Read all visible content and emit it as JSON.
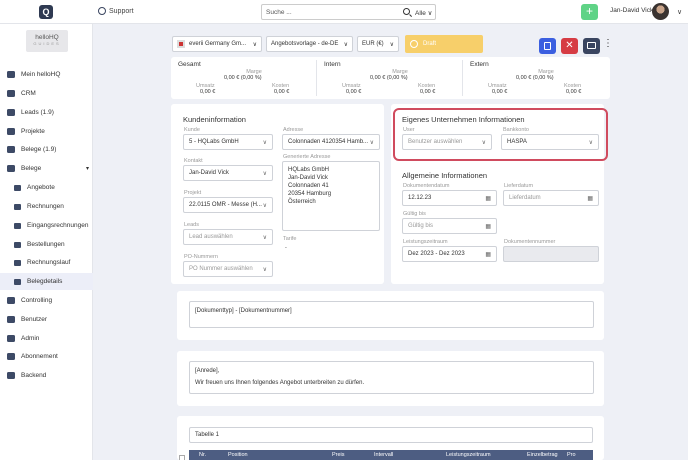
{
  "header": {
    "logo": "Q",
    "support": "Support",
    "search_placeholder": "Suche ...",
    "search_scope": "Alle",
    "plus": "+",
    "user_name": "Jan-David Vick",
    "chevron": "∨"
  },
  "brand": {
    "name": "helloHQ",
    "sub": "GUIDES"
  },
  "sidebar": {
    "items": [
      {
        "label": "Mein helloHQ",
        "icon": "home-icon"
      },
      {
        "label": "CRM",
        "icon": "crm-icon"
      },
      {
        "label": "Leads (1.9)",
        "icon": "leads-icon"
      },
      {
        "label": "Projekte",
        "icon": "projects-icon"
      },
      {
        "label": "Belege (1.9)",
        "icon": "receipts-icon"
      },
      {
        "label": "Belege",
        "icon": "documents-icon",
        "caret": "▾"
      },
      {
        "label": "Angebote",
        "icon": "offers-icon"
      },
      {
        "label": "Rechnungen",
        "icon": "invoices-icon"
      },
      {
        "label": "Eingangsrechnungen",
        "icon": "incoming-invoices-icon"
      },
      {
        "label": "Bestellungen",
        "icon": "orders-icon"
      },
      {
        "label": "Rechnungslauf",
        "icon": "invoice-run-icon"
      },
      {
        "label": "Belegdetails",
        "icon": "document-details-icon"
      },
      {
        "label": "Controlling",
        "icon": "controlling-icon"
      },
      {
        "label": "Benutzer",
        "icon": "users-icon"
      },
      {
        "label": "Admin",
        "icon": "admin-icon"
      },
      {
        "label": "Abonnement",
        "icon": "subscription-icon"
      },
      {
        "label": "Backend",
        "icon": "backend-icon"
      }
    ]
  },
  "toolbar": {
    "company": "everii Germany Gm...",
    "template": "Angebotsvorlage - de-DE",
    "currency": "EUR (€)",
    "status": "Draft",
    "more": "⋮"
  },
  "summary": [
    {
      "title": "Gesamt",
      "marge_label": "Marge",
      "marge": "0,00 € (0,00 %)",
      "umsatz_label": "Umsatz",
      "umsatz": "0,00 €",
      "kosten_label": "Kosten",
      "kosten": "0,00 €"
    },
    {
      "title": "Intern",
      "marge_label": "Marge",
      "marge": "0,00 € (0,00 %)",
      "umsatz_label": "Umsatz",
      "umsatz": "0,00 €",
      "kosten_label": "Kosten",
      "kosten": "0,00 €"
    },
    {
      "title": "Extern",
      "marge_label": "Marge",
      "marge": "0,00 € (0,00 %)",
      "umsatz_label": "Umsatz",
      "umsatz": "0,00 €",
      "kosten_label": "Kosten",
      "kosten": "0,00 €"
    }
  ],
  "kunde": {
    "title": "Kundeninformation",
    "kunde_label": "Kunde",
    "kunde": "5 - HQLabs GmbH",
    "adresse_label": "Adresse",
    "adresse": "Colonnaden 4120354 Hamb...",
    "kontakt_label": "Kontakt",
    "kontakt": "Jan-David Vick",
    "gen_adresse_label": "Generierte Adresse",
    "gen_adresse": [
      "HQLabs GmbH",
      "Jan-David Vick",
      "Colonnaden 41",
      "20354 Hamburg",
      "Österreich"
    ],
    "projekt_label": "Projekt",
    "projekt": "22.0115 OMR - Messe (H...",
    "leads_label": "Leads",
    "leads_placeholder": "Lead auswählen",
    "tarife_label": "Tarife",
    "tarife": "-",
    "po_label": "PO-Nummern",
    "po_placeholder": "PO Nummer auswählen"
  },
  "eigenes": {
    "title": "Eigenes Unternehmen Informationen",
    "user_label": "User",
    "user_placeholder": "Benutzer auswählen",
    "bank_label": "Bankkonto",
    "bank": "HASPA"
  },
  "allgemein": {
    "title": "Allgemeine Informationen",
    "dokdatum_label": "Dokumentendatum",
    "dokdatum": "12.12.23",
    "liefer_label": "Lieferdatum",
    "liefer_placeholder": "Lieferdatum",
    "gueltig_label": "Gültig bis",
    "gueltig_placeholder": "Gültig bis",
    "leistung_label": "Leistungszeitraum",
    "leistung": "Dez 2023 - Dez 2023",
    "doknr_label": "Dokumentennummer"
  },
  "doctitle": "[Dokumenttyp] - [Dokumentnummer]",
  "anrede": {
    "line1": "[Anrede],",
    "line2": "Wir freuen uns Ihnen folgendes Angebot unterbreiten zu dürfen."
  },
  "table": {
    "name": "Tabelle 1",
    "columns": [
      "Nr.",
      "Position",
      "Preis",
      "Intervall",
      "Leistungszeitraum",
      "Einzelbetrag",
      "Pro"
    ]
  }
}
